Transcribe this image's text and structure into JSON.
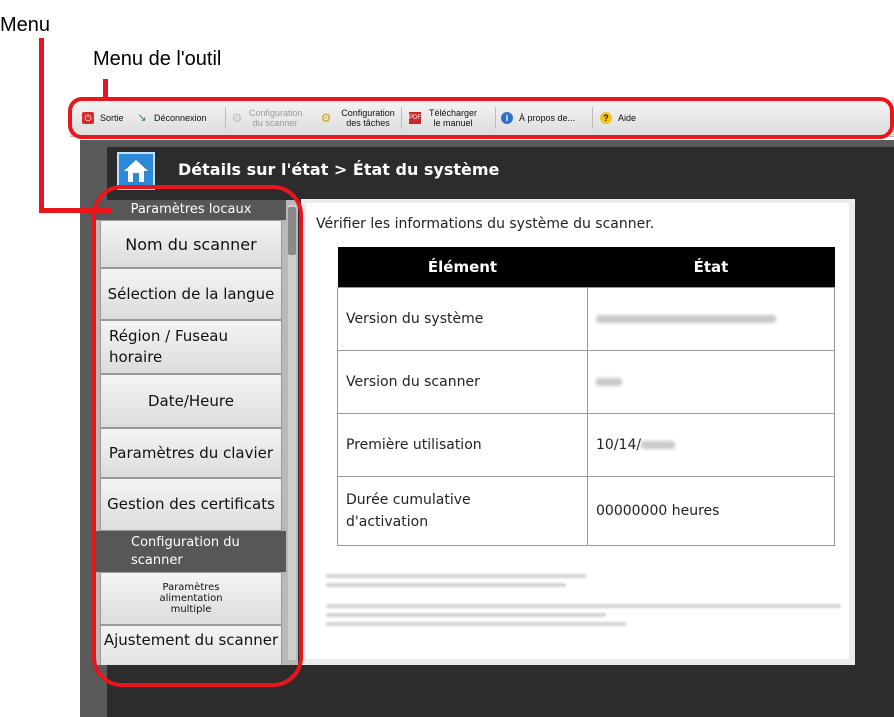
{
  "annotations": {
    "menu": "Menu",
    "tool_menu": "Menu de l'outil"
  },
  "toolbar": {
    "exit": "Sortie",
    "logout": "Déconnexion",
    "scanner_config": "Configuration du scanner",
    "task_config": "Configuration des tâches",
    "download_manual": "Télécharger le manuel",
    "about": "À propos de...",
    "help": "Aide"
  },
  "page": {
    "title": "Détails sur l'état > État du système"
  },
  "sidebar": {
    "section_local": "Paramètres locaux",
    "items": [
      "Nom du scanner",
      "Sélection de la langue",
      "Région / Fuseau horaire",
      "Date/Heure",
      "Paramètres du clavier",
      "Gestion des certificats"
    ],
    "section_scanner": "Configuration du scanner",
    "items2": [
      "Paramètres alimentation multiple",
      "Ajustement du scanner"
    ]
  },
  "main": {
    "intro": "Vérifier les informations du système du scanner.",
    "table": {
      "headers": [
        "Élément",
        "État"
      ],
      "rows": [
        {
          "item": "Version du système",
          "state": ""
        },
        {
          "item": "Version du scanner",
          "state": ""
        },
        {
          "item": "Première utilisation",
          "state": "10/14/"
        },
        {
          "item": "Durée cumulative d'activation",
          "state": "00000000 heures"
        }
      ]
    }
  }
}
